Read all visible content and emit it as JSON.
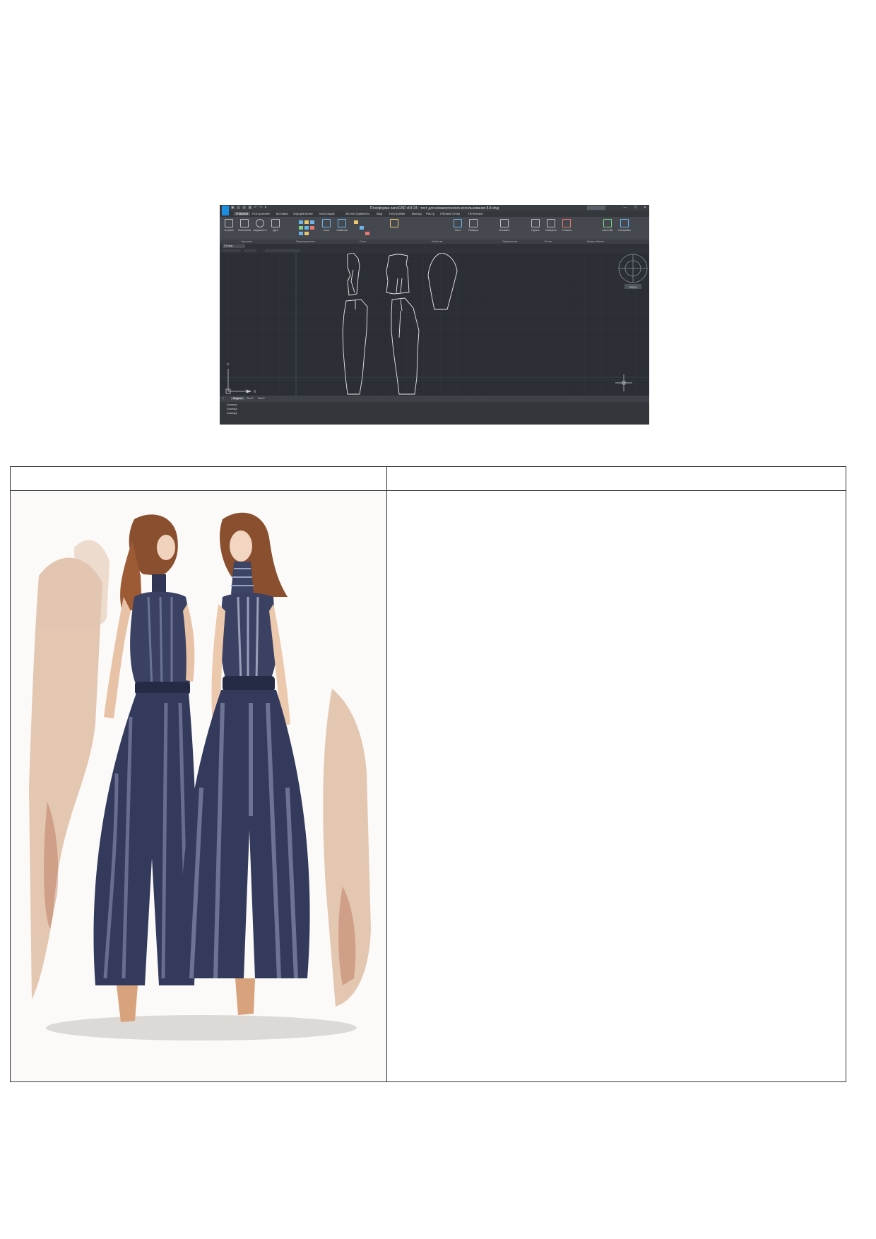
{
  "cad": {
    "title": "Платформа nanoCAD x64 24 - тест для коммерческого использования 8.8.dwg",
    "quick_access": "▣ ▤ ▥ ▦ ↶ ↷ ▾",
    "window_controls": "— ❐ ✕",
    "ribbon_tabs": [
      "Главная",
      "Построение",
      "Вставка",
      "Оформление",
      "Аннотации",
      "3D инструменты",
      "Вид",
      "Настройки",
      "Вывод",
      "Растр",
      "Облака точек",
      "Печатные"
    ],
    "active_tab_index": 0,
    "ribbon_buttons": [
      "Отрезок",
      "Полилиния",
      "Окружность",
      "Дуга",
      "Слои",
      "Свойства",
      "Текст",
      "Размеры",
      "Вставить",
      "Группы",
      "Измерить",
      "Утилиты",
      "nanoCAD",
      "Настройки"
    ],
    "ribbon_panels": [
      "Черчение",
      "Редактирование",
      "Слои",
      "Свойства",
      "Оформление",
      "Блоки",
      "Буфер обмена"
    ],
    "document_tab": "8.8.dwg",
    "layout_tabs": [
      "Модель",
      "Лист1",
      "Лист2"
    ],
    "console_lines": [
      "Команда:",
      "Команда:",
      "Команда:"
    ],
    "axis_x": "X",
    "axis_y": "Y",
    "viewcube_label": "Сверху"
  },
  "table": {
    "header_left": "",
    "header_right": ""
  },
  "colors": {
    "cad_background": "#2b2f35",
    "pattern_lines": "#e8e8e8",
    "grid_line": "#363b41",
    "grid_major": "#3f5a44"
  }
}
